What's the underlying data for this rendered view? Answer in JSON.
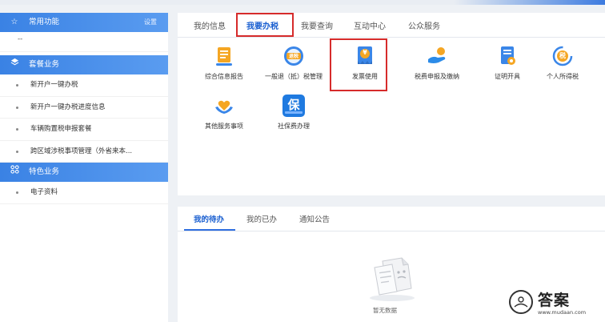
{
  "sidebar": {
    "common": {
      "title": "常用功能",
      "settings": "设置",
      "placeholder": "--"
    },
    "packages": {
      "title": "套餐业务",
      "items": [
        "新开户一键办税",
        "新开户一键办税进度信息",
        "车辆购置税申报套餐",
        "跨区域涉税事项管理（外省来本..."
      ]
    },
    "special": {
      "title": "特色业务",
      "items": [
        "电子资料"
      ]
    }
  },
  "top_tabs": [
    "我的信息",
    "我要办税",
    "我要查询",
    "互动中心",
    "公众服务"
  ],
  "tiles": [
    {
      "label": "综合信息报告",
      "icon": "report-icon",
      "color": "#f3a31b"
    },
    {
      "label": "一般退（抵）税管理",
      "icon": "tax-refund-icon",
      "badge": "退税",
      "color": "#3a86e8"
    },
    {
      "label": "发票使用",
      "icon": "invoice-icon",
      "badge": "¥",
      "color": "#3a86e8"
    },
    {
      "label": "税费申报及缴纳",
      "icon": "declare-pay-icon",
      "color": "#2c8be8"
    },
    {
      "label": "证明开具",
      "icon": "certificate-icon",
      "color": "#3a86e8"
    },
    {
      "label": "个人所得税",
      "icon": "income-tax-icon",
      "badge": "税",
      "color": "#f3a31b"
    },
    {
      "label": "其他服务事项",
      "icon": "heart-hands-icon",
      "color": "#3a86e8"
    },
    {
      "label": "社保费办理",
      "icon": "social-security-icon",
      "badge": "保",
      "color": "#1f7ae0"
    }
  ],
  "bottom_tabs": [
    "我的待办",
    "我的已办",
    "通知公告"
  ],
  "empty": {
    "text": "暂无数据"
  },
  "watermark": {
    "text": "答案",
    "url": "www.mudaan.com"
  }
}
